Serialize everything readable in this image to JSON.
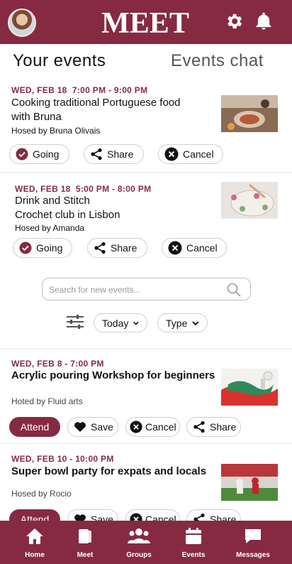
{
  "header": {
    "logo_text": "MEET",
    "avatar_icon": "user-avatar",
    "settings_icon": "gear-icon",
    "notifications_icon": "bell-icon"
  },
  "tabs": {
    "your_events": "Your events",
    "events_chat": "Events chat"
  },
  "my_events": [
    {
      "date": "WED, FEB 18  7:00 PM - 9:00 PM",
      "title_lines": [
        "Cooking traditional Portuguese food",
        "with Bruna"
      ],
      "host": "Hosed by Bruna Olivais",
      "going_label": "Going",
      "share_label": "Share",
      "cancel_label": "Cancel"
    },
    {
      "date": "WED, FEB 18  5:00 PM - 8:00 PM",
      "title_lines": [
        "Drink and Stitch",
        "Crochet club in Lisbon"
      ],
      "host": "Hosed by Amanda",
      "going_label": "Going",
      "share_label": "Share",
      "cancel_label": "Cancel"
    }
  ],
  "search": {
    "placeholder": "Search for new events..."
  },
  "filters": {
    "date_label": "Today",
    "type_label": "Type"
  },
  "new_events": [
    {
      "date": "WED, FEB 8 - 7:00 PM",
      "title": "Acrylic pouring Workshop for beginners",
      "host": "Hoted by Fluid arts",
      "attend_label": "Attend",
      "save_label": "Save",
      "cancel_label": "Cancel",
      "share_label": "Share"
    },
    {
      "date": "WED, FEB 10 - 10:00 PM",
      "title": "Super bowl party for expats and locals",
      "host": "Hosed by Rocio",
      "attend_label": "Attend",
      "save_label": "Save",
      "cancel_label": "Cancel",
      "share_label": "Share"
    }
  ],
  "bottom_nav": [
    {
      "label": "Home",
      "icon": "home-icon"
    },
    {
      "label": "Meet",
      "icon": "cards-icon"
    },
    {
      "label": "Groups",
      "icon": "group-icon"
    },
    {
      "label": "Events",
      "icon": "calendar-icon"
    },
    {
      "label": "Messages",
      "icon": "chat-icon"
    }
  ],
  "colors": {
    "brand": "#862a42",
    "background": "#ffffff",
    "pill_border": "#cfcfcf"
  }
}
